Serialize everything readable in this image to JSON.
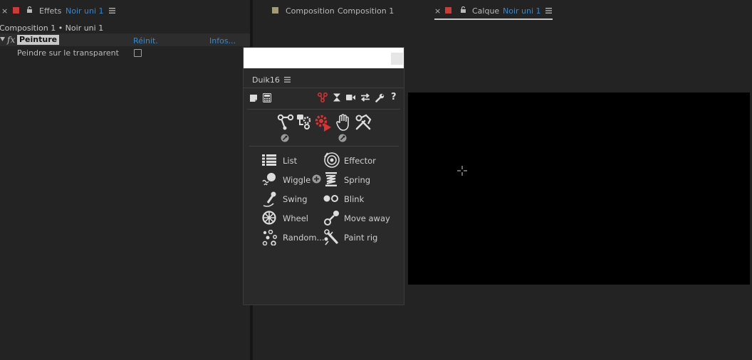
{
  "effects_panel": {
    "tab_close": "×",
    "tab_title": "Effets",
    "tab_layer": "Noir uni 1",
    "breadcrumb": "Composition 1 • Noir uni 1",
    "fx_label": "fx",
    "effect_name": "Peinture",
    "reset_label": "Réinit.",
    "info_label": "Infos...",
    "paint_transparent_label": "Peindre sur le transparent"
  },
  "composition_tab": {
    "label": "Composition",
    "name": "Composition 1"
  },
  "layer_tab": {
    "close": "×",
    "label": "Calque",
    "layer": "Noir uni 1"
  },
  "duik": {
    "title": "Duik16",
    "menu_items": {
      "list": "List",
      "effector": "Effector",
      "wiggle": "Wiggle",
      "spring": "Spring",
      "swing": "Swing",
      "blink": "Blink",
      "wheel": "Wheel",
      "move_away": "Move away",
      "random": "Random...",
      "paint_rig": "Paint rig"
    }
  },
  "colors": {
    "accent_blue": "#2e8ad8",
    "duik_red": "#e03030",
    "panel_bg": "#232323"
  }
}
